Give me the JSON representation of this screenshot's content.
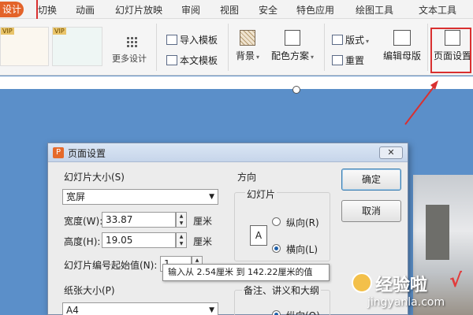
{
  "tabs": {
    "active": "设计",
    "items": [
      "切换",
      "动画",
      "幻灯片放映",
      "审阅",
      "视图",
      "安全",
      "特色应用",
      "绘图工具",
      "文本工具"
    ]
  },
  "ribbon": {
    "vip_badge": "VIP",
    "more_designs": "更多设计",
    "import_template": "导入模板",
    "body_template": "本文模板",
    "background": "背景",
    "color_scheme": "配色方案",
    "layout": "版式",
    "reset": "重置",
    "edit_master": "编辑母版",
    "page_setup": "页面设置"
  },
  "dialog": {
    "title": "页面设置",
    "close": "✕",
    "slide_size_label": "幻灯片大小(S)",
    "slide_size_value": "宽屏",
    "width_label": "宽度(W):",
    "width_value": "33.87",
    "height_label": "高度(H):",
    "height_value": "19.05",
    "unit": "厘米",
    "numbering_label": "幻灯片编号起始值(N):",
    "numbering_value": "1",
    "paper_size_label": "纸张大小(P)",
    "paper_size_value": "A4",
    "orientation_label": "方向",
    "slides_label": "幻灯片",
    "portrait": "纵向(R)",
    "landscape": "横向(L)",
    "notes_label": "备注、讲义和大纲",
    "notes_portrait": "纵向(O)",
    "ok": "确定",
    "cancel": "取消"
  },
  "tooltip": "输入从 2.54厘米 到 142.22厘米的值",
  "watermark": {
    "title": "经验啦",
    "check": "√",
    "url": "jingyanla.com"
  },
  "colors": {
    "accent": "#e3632a",
    "highlight": "#d93030",
    "workspace": "#5b8fc9"
  }
}
